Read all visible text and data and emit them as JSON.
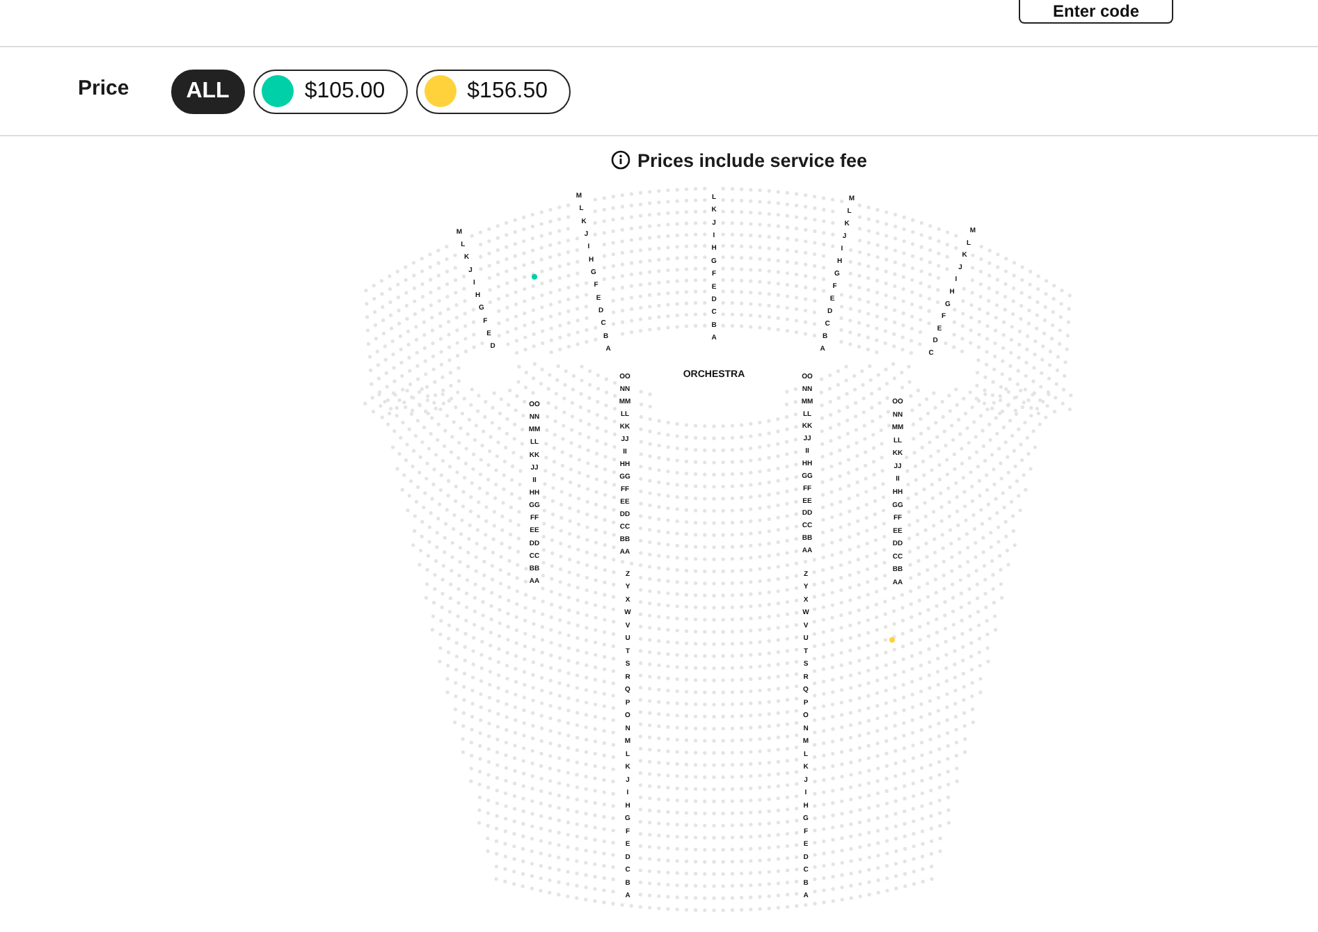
{
  "header": {
    "button": "Enter code"
  },
  "price_filter": {
    "label": "Price",
    "options": [
      {
        "label": "ALL",
        "kind": "all",
        "selected": true
      },
      {
        "label": "$105.00",
        "kind": "price",
        "selected": false,
        "color": "#00d0a8"
      },
      {
        "label": "$156.50",
        "kind": "price",
        "selected": false,
        "color": "#ffd23c"
      }
    ]
  },
  "notice": "Prices include service fee",
  "seat_map": {
    "section_label": "ORCHESTRA",
    "row_label_columns": [
      {
        "labels": [
          "M",
          "L",
          "K",
          "J",
          "I",
          "H",
          "G",
          "F",
          "E",
          "D"
        ]
      },
      {
        "labels": [
          "M",
          "L",
          "K",
          "J",
          "I",
          "H",
          "G",
          "F",
          "E",
          "D",
          "C",
          "B",
          "A"
        ]
      },
      {
        "labels": [
          "L",
          "K",
          "J",
          "I",
          "H",
          "G",
          "F",
          "E",
          "D",
          "C",
          "B",
          "A"
        ]
      },
      {
        "labels": [
          "M",
          "L",
          "K",
          "J",
          "I",
          "H",
          "G",
          "F",
          "E",
          "D",
          "C",
          "B",
          "A"
        ]
      },
      {
        "labels": [
          "M",
          "L",
          "K",
          "J",
          "I",
          "H",
          "G",
          "F",
          "E",
          "D",
          "C"
        ]
      },
      {
        "labels": [
          "OO",
          "NN",
          "MM",
          "LL",
          "KK",
          "JJ",
          "II",
          "HH",
          "GG",
          "FF",
          "EE",
          "DD",
          "CC",
          "BB",
          "AA"
        ]
      },
      {
        "labels": [
          "OO",
          "NN",
          "MM",
          "LL",
          "KK",
          "JJ",
          "II",
          "HH",
          "GG",
          "FF",
          "EE",
          "DD",
          "CC",
          "BB",
          "AA"
        ]
      },
      {
        "labels": [
          "OO",
          "NN",
          "MM",
          "LL",
          "KK",
          "JJ",
          "II",
          "HH",
          "GG",
          "FF",
          "EE",
          "DD",
          "CC",
          "BB",
          "AA"
        ]
      },
      {
        "labels": [
          "OO",
          "NN",
          "MM",
          "LL",
          "KK",
          "JJ",
          "II",
          "HH",
          "GG",
          "FF",
          "EE",
          "DD",
          "CC",
          "BB",
          "AA"
        ]
      },
      {
        "labels": [
          "Z",
          "Y",
          "X",
          "W",
          "V",
          "U",
          "T",
          "S",
          "R",
          "Q",
          "P",
          "O",
          "N",
          "M",
          "L",
          "K",
          "J",
          "I",
          "H",
          "G",
          "F",
          "E",
          "D",
          "C",
          "B",
          "A"
        ]
      },
      {
        "labels": [
          "Z",
          "Y",
          "X",
          "W",
          "V",
          "U",
          "T",
          "S",
          "R",
          "Q",
          "P",
          "O",
          "N",
          "M",
          "L",
          "K",
          "J",
          "I",
          "H",
          "G",
          "F",
          "E",
          "D",
          "C",
          "B",
          "A"
        ]
      }
    ],
    "available_seats": [
      {
        "color": "#00d0a8"
      },
      {
        "color": "#ffd23c"
      }
    ]
  }
}
